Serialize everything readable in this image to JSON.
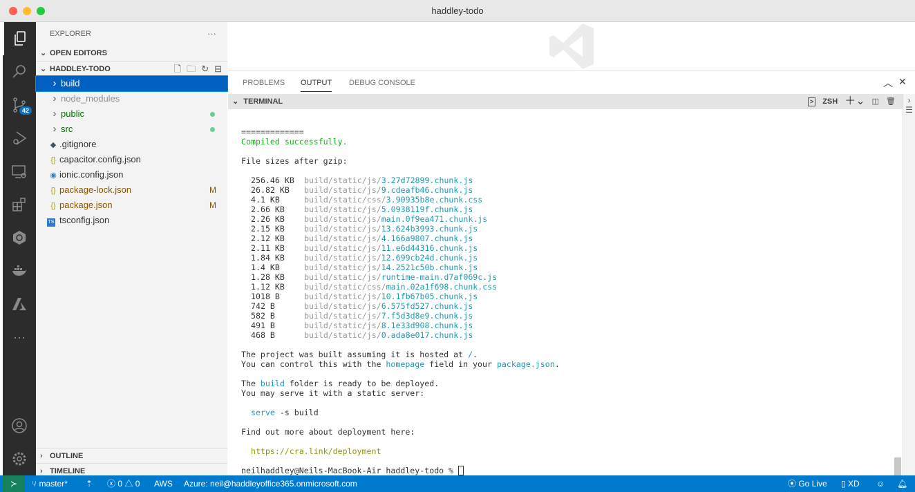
{
  "window": {
    "title": "haddley-todo"
  },
  "activity": {
    "scm_badge": "42"
  },
  "explorer": {
    "title": "EXPLORER",
    "more": "···",
    "open_editors": "OPEN EDITORS",
    "folder": "HADDLEY-TODO",
    "items": [
      {
        "name": "build",
        "type": "folder",
        "color": "#ffffff",
        "selected": true,
        "icon": "chevron-right"
      },
      {
        "name": "node_modules",
        "type": "folder",
        "color": "#8e8e8e",
        "icon": "chevron-right"
      },
      {
        "name": "public",
        "type": "folder",
        "color": "#007100",
        "dot": true,
        "icon": "chevron-right"
      },
      {
        "name": "src",
        "type": "folder",
        "color": "#007100",
        "dot": true,
        "icon": "chevron-right"
      },
      {
        "name": ".gitignore",
        "type": "file",
        "color": "#333333",
        "icon": "git",
        "glyph": "◆"
      },
      {
        "name": "capacitor.config.json",
        "type": "file",
        "color": "#333333",
        "icon": "json",
        "glyph": "{}"
      },
      {
        "name": "ionic.config.json",
        "type": "file",
        "color": "#333333",
        "icon": "ionic",
        "glyph": "◉"
      },
      {
        "name": "package-lock.json",
        "type": "file",
        "color": "#895503",
        "badge": "M",
        "icon": "json",
        "glyph": "{}"
      },
      {
        "name": "package.json",
        "type": "file",
        "color": "#895503",
        "badge": "M",
        "icon": "json",
        "glyph": "{}"
      },
      {
        "name": "tsconfig.json",
        "type": "file",
        "color": "#333333",
        "icon": "ts",
        "glyph": "TS"
      }
    ],
    "outline": "OUTLINE",
    "timeline": "TIMELINE"
  },
  "panel": {
    "tabs": [
      "PROBLEMS",
      "OUTPUT",
      "DEBUG CONSOLE"
    ],
    "active_tab": "OUTPUT",
    "terminal_label": "TERMINAL",
    "shell": "ZSH"
  },
  "terminal": {
    "lines": [
      [
        [
          "=============",
          ""
        ]
      ],
      [
        [
          "Compiled successfully.",
          "g"
        ]
      ],
      [
        [
          "",
          ""
        ]
      ],
      [
        [
          "File sizes after gzip:",
          ""
        ]
      ],
      [
        [
          "",
          ""
        ]
      ]
    ],
    "files": [
      [
        "256.46 KB",
        "build/static/js/",
        "3.27d72899.chunk.js"
      ],
      [
        "26.82 KB",
        "build/static/js/",
        "9.cdeafb46.chunk.js"
      ],
      [
        "4.1 KB",
        "build/static/css/",
        "3.90935b8e.chunk.css"
      ],
      [
        "2.66 KB",
        "build/static/js/",
        "5.0938119f.chunk.js"
      ],
      [
        "2.26 KB",
        "build/static/js/",
        "main.0f9ea471.chunk.js"
      ],
      [
        "2.15 KB",
        "build/static/js/",
        "13.624b3993.chunk.js"
      ],
      [
        "2.12 KB",
        "build/static/js/",
        "4.166a9807.chunk.js"
      ],
      [
        "2.11 KB",
        "build/static/js/",
        "11.e6d44316.chunk.js"
      ],
      [
        "1.84 KB",
        "build/static/js/",
        "12.699cb24d.chunk.js"
      ],
      [
        "1.4 KB",
        "build/static/js/",
        "14.2521c50b.chunk.js"
      ],
      [
        "1.28 KB",
        "build/static/js/",
        "runtime-main.d7af069c.js"
      ],
      [
        "1.12 KB",
        "build/static/css/",
        "main.02a1f698.chunk.css"
      ],
      [
        "1018 B",
        "build/static/js/",
        "10.1fb67b05.chunk.js"
      ],
      [
        "742 B",
        "build/static/js/",
        "6.575fd527.chunk.js"
      ],
      [
        "582 B",
        "build/static/js/",
        "7.f5d3d8e9.chunk.js"
      ],
      [
        "491 B",
        "build/static/js/",
        "8.1e33d908.chunk.js"
      ],
      [
        "468 B",
        "build/static/js/",
        "0.ada8e017.chunk.js"
      ]
    ],
    "after": [
      [
        [
          "",
          ""
        ]
      ],
      [
        [
          "The project was built assuming it is hosted at ",
          ""
        ],
        [
          "/",
          "c"
        ],
        [
          ".",
          ""
        ]
      ],
      [
        [
          "You can control this with the ",
          ""
        ],
        [
          "homepage",
          "c"
        ],
        [
          " field in your ",
          ""
        ],
        [
          "package.json",
          "c"
        ],
        [
          ".",
          ""
        ]
      ],
      [
        [
          "",
          ""
        ]
      ],
      [
        [
          "The ",
          ""
        ],
        [
          "build",
          "c"
        ],
        [
          " folder is ready to be deployed.",
          ""
        ]
      ],
      [
        [
          "You may serve it with a static server:",
          ""
        ]
      ],
      [
        [
          "",
          ""
        ]
      ],
      [
        [
          "  ",
          ""
        ],
        [
          "serve",
          "c"
        ],
        [
          " -s build",
          ""
        ]
      ],
      [
        [
          "",
          ""
        ]
      ],
      [
        [
          "Find out more about deployment here:",
          ""
        ]
      ],
      [
        [
          "",
          ""
        ]
      ],
      [
        [
          "  https://cra.link/deployment",
          "y"
        ]
      ],
      [
        [
          "",
          ""
        ]
      ],
      [
        [
          "neilhaddley@Neils-MacBook-Air haddley-todo % ",
          ""
        ]
      ]
    ]
  },
  "status": {
    "branch": "master*",
    "errors": "0",
    "warnings": "0",
    "aws": "AWS",
    "azure": "Azure: neil@haddleyoffice365.onmicrosoft.com",
    "golive": "Go Live",
    "xd": "XD"
  }
}
